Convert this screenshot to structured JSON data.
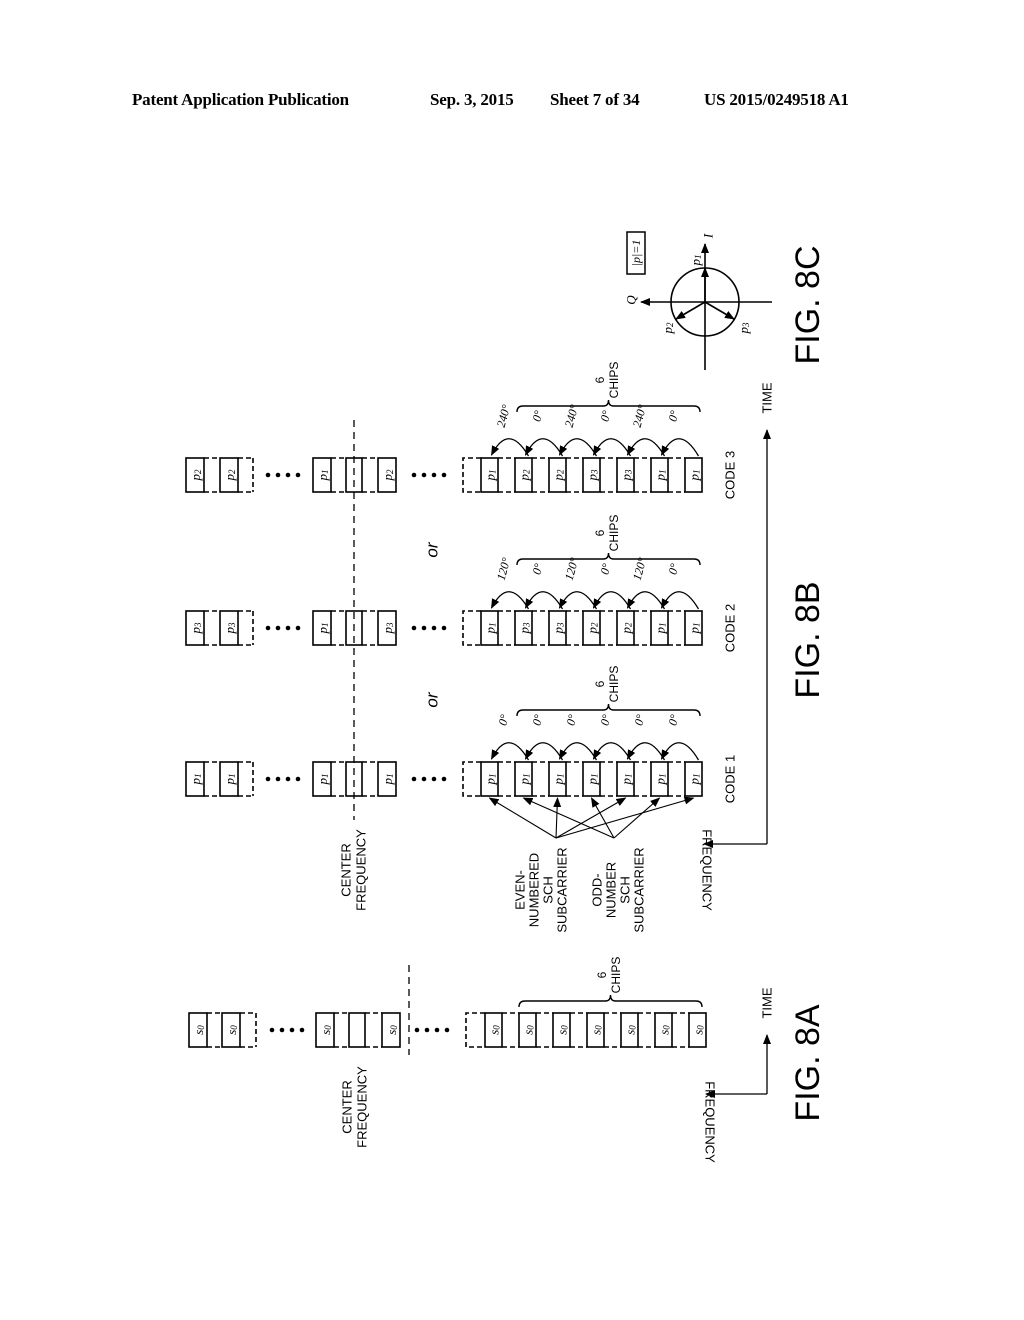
{
  "header": {
    "publication": "Patent Application Publication",
    "date": "Sep. 3, 2015",
    "sheet": "Sheet 7 of 34",
    "number": "US 2015/0249518 A1"
  },
  "fig8a": {
    "label": "FIG. 8A",
    "center_label": [
      "CENTER",
      "FREQUENCY"
    ],
    "chip_symbol": "s0",
    "chips_label": [
      "6",
      "CHIPS"
    ],
    "axis_time": "TIME",
    "axis_frequency": "FREQUENCY"
  },
  "fig8b": {
    "label": "FIG. 8B",
    "center_label": [
      "CENTER",
      "FREQUENCY"
    ],
    "even_label": [
      "EVEN-",
      "NUMBERED",
      "SCH",
      "SUBCARRIER"
    ],
    "odd_label": [
      "ODD-",
      "NUMBER",
      "SCH",
      "SUBCARRIER"
    ],
    "axis_time": "TIME",
    "axis_frequency": "FREQUENCY",
    "or_label": "or",
    "chips_label": [
      "6",
      "CHIPS"
    ],
    "codes": [
      {
        "name": "CODE 1",
        "left": [
          "p1",
          "p1"
        ],
        "center": [
          "p1",
          "",
          "p1"
        ],
        "chips": [
          "p1",
          "p1",
          "p1",
          "p1",
          "p1",
          "p1",
          "p1"
        ],
        "phases": [
          "0°",
          "0°",
          "0°",
          "0°",
          "0°",
          "0°"
        ]
      },
      {
        "name": "CODE 2",
        "left": [
          "p3",
          "p3"
        ],
        "center": [
          "p1",
          "",
          "p3"
        ],
        "chips": [
          "p1",
          "p3",
          "p3",
          "p2",
          "p2",
          "p1",
          "p1"
        ],
        "phases": [
          "120°",
          "0°",
          "120°",
          "0°",
          "120°",
          "0°"
        ]
      },
      {
        "name": "CODE 3",
        "left": [
          "p2",
          "p2"
        ],
        "center": [
          "p1",
          "",
          "p2"
        ],
        "chips": [
          "p1",
          "p2",
          "p2",
          "p3",
          "p3",
          "p1",
          "p1"
        ],
        "phases": [
          "240°",
          "0°",
          "240°",
          "0°",
          "240°",
          "0°"
        ]
      }
    ]
  },
  "fig8c": {
    "label": "FIG. 8C",
    "magnitude": "|p|=1",
    "axis_i": "I",
    "axis_q": "Q",
    "points": [
      "p1",
      "p2",
      "p3"
    ]
  }
}
